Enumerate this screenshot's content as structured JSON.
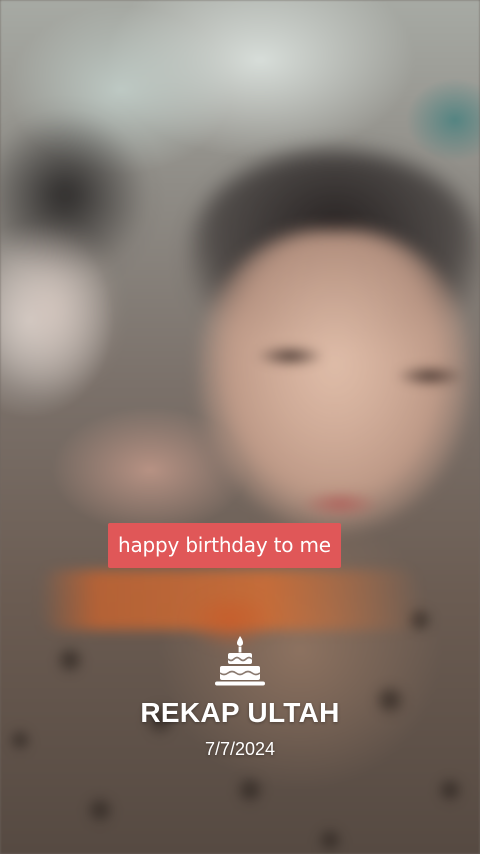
{
  "background": {
    "icon": "blurred-photo-background"
  },
  "caption": {
    "text": "happy birthday to me",
    "bg_color": "#e05758",
    "text_color": "#ffffff"
  },
  "overlay": {
    "icon": "birthday-cake-icon",
    "title": "REKAP ULTAH",
    "date": "7/7/2024"
  }
}
